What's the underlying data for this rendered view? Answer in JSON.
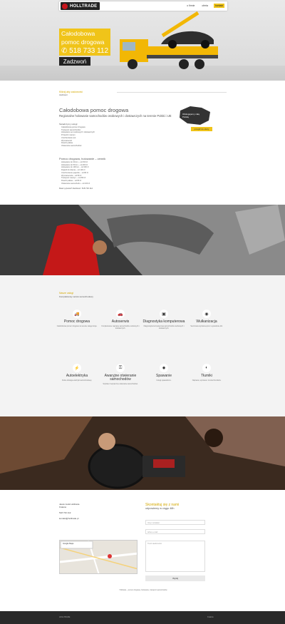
{
  "header": {
    "logo_text": "HOLLTRADE",
    "menu": [
      {
        "label": "o firmie",
        "active": false
      },
      {
        "label": "oferta",
        "active": false
      },
      {
        "label": "kontakt",
        "active": true
      }
    ]
  },
  "hero": {
    "line1": "Całodobowa",
    "line2": "pomoc drogowa",
    "phone": "518 733 112",
    "call_label": "Zadzwoń"
  },
  "intro": {
    "small_title": "Kliknij aby zadzwonić",
    "small_sub": "zadzwoń",
    "title": "Całodobowa pomoc drogowa",
    "subtitle": "Regionalne holowanie samochodów osobowych i dostawczych na terenie Polski i UE",
    "list1_head": "Świadczymy usługi:",
    "list1": [
      "Całodobowa pomoc drogowa",
      "Transport samochodów",
      "Holowanie aut osobowych i dostawczych",
      "Przewóz maszyn",
      "Uruchamianie aut",
      "Wymiana kół",
      "Dowóz paliwa",
      "Otwieranie samochodów"
    ],
    "region_note": "Obsługujemy całą Polskę",
    "region_button": "przejdź do oferty",
    "list2_head": "Pomoc drogowa, holowanie – cennik",
    "list2": [
      "Holowanie do 30 km – od 150 zł",
      "Holowanie do 50 km – od 200 zł",
      "Holowanie do 100 km – od 300 zł",
      "Dojazd do klienta – od 100 zł",
      "Uruchomienie pojazdu – od 80 zł",
      "Wymiana koła – od 80 zł",
      "Transport maszyn – od 250 zł",
      "Dowóz paliwa – od 80 zł",
      "Otwieranie samochodu – od 100 zł"
    ],
    "closing": "Masz pytania? Zadzwoń: 518 733 112"
  },
  "services": {
    "title": "Nasze usługi",
    "subtitle": "Kompleksowy serwis samochodowy",
    "items": [
      {
        "name": "Pomoc drogowa",
        "icon": "tow-truck-icon",
        "desc": "Całodobowa pomoc drogowa na terenie całego kraju."
      },
      {
        "name": "Autoserwis",
        "icon": "car-service-icon",
        "desc": "Kompleksowe naprawy samochodów osobowych i dostawczych."
      },
      {
        "name": "Diagnostyka komputerowa",
        "icon": "diagnostics-icon",
        "desc": "Diagnostyka komputerowa samochodów osobowych i dostawczych."
      },
      {
        "name": "Wulkanizacja",
        "icon": "tire-icon",
        "desc": "Sezonowa wymiana opon i wyważanie kół."
      },
      {
        "name": "Autoelektryka",
        "icon": "electric-icon",
        "desc": "Pełna obsługa elektryki samochodowej."
      },
      {
        "name": "Awaryjne otwieranie samochodów",
        "icon": "key-icon",
        "desc": "Szybkie i bezpieczne otwieranie samochodów."
      },
      {
        "name": "Spawanie",
        "icon": "welding-icon",
        "desc": "Usługi spawalnicze."
      },
      {
        "name": "Tłumiki",
        "icon": "exhaust-icon",
        "desc": "Naprawa, wymiana i montaż tłumików."
      }
    ]
  },
  "contact": {
    "company": "Jacek Janik Holltrade",
    "city": "Kraków",
    "phone": "518 733 112",
    "email": "kontakt@holltrade.pl",
    "map_label": "Google Maps",
    "form_title": "Skontaktuj się z nami",
    "form_sub": "odpowiemy w ciągu 48h",
    "name_placeholder": "Imię i nazwisko",
    "email_placeholder": "Adres e-mail",
    "message_placeholder": "Treść wiadomości",
    "send_label": "Wyślij"
  },
  "footer": {
    "note": "Holltrade – pomoc drogowa, holowanie, transport samochodów",
    "left": "HOLLTRADE",
    "right": "Kraków"
  },
  "colors": {
    "accent": "#f0c419",
    "dark": "#222222"
  }
}
